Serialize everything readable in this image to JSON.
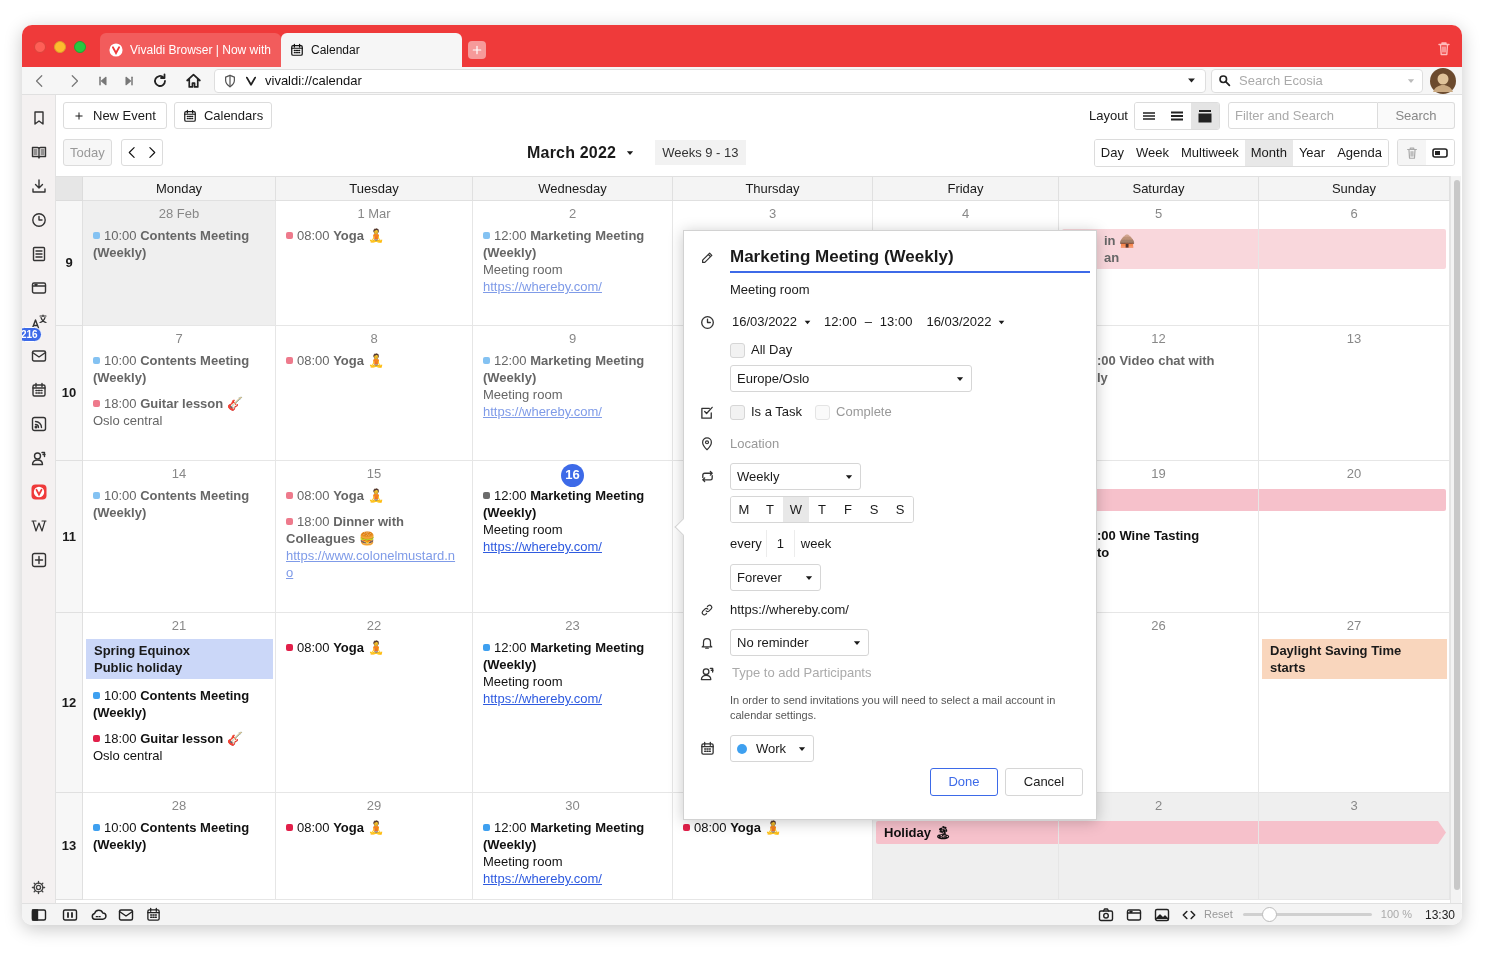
{
  "tabs": [
    {
      "title": "Vivaldi Browser | Now with",
      "selected": false,
      "kind": "vivaldi"
    },
    {
      "title": "Calendar",
      "selected": true,
      "kind": "calendar"
    }
  ],
  "address_bar": {
    "url": "vivaldi://calendar",
    "search_placeholder": "Search Ecosia"
  },
  "sidebar": {
    "mail_badge": "216"
  },
  "toolbar": {
    "new_event": "New Event",
    "calendars": "Calendars",
    "layout_label": "Layout",
    "layouts": [
      {
        "selected": false
      },
      {
        "selected": false
      },
      {
        "selected": true
      }
    ],
    "filter_placeholder": "Filter and Search",
    "search_button": "Search",
    "today": "Today",
    "today_disabled": true,
    "month_title": "March 2022",
    "weeks_label": "Weeks 9 - 13",
    "views": [
      {
        "label": "Day",
        "selected": false
      },
      {
        "label": "Week",
        "selected": false
      },
      {
        "label": "Multiweek",
        "selected": false
      },
      {
        "label": "Month",
        "selected": true
      },
      {
        "label": "Year",
        "selected": false
      },
      {
        "label": "Agenda",
        "selected": false
      }
    ]
  },
  "calendar": {
    "days": [
      "Monday",
      "Tuesday",
      "Wednesday",
      "Thursday",
      "Friday",
      "Saturday",
      "Sunday"
    ],
    "weeks": [
      {
        "number": "9",
        "cells": [
          {
            "date": "28 Feb",
            "other_month": true,
            "events": [
              {
                "kind": "timed",
                "color": "#84c2f2",
                "past": true,
                "text": "10:00 **Contents Meeting (Weekly)**"
              }
            ]
          },
          {
            "date": "1 Mar",
            "other_month": false,
            "events": [
              {
                "kind": "timed",
                "color": "#ee7a8c",
                "past": true,
                "text": "08:00 **Yoga** 🧘"
              }
            ]
          },
          {
            "date": "2",
            "other_month": false,
            "events": [
              {
                "kind": "timed",
                "color": "#84c2f2",
                "past": true,
                "text": "12:00 **Marketing Meeting (Weekly)**",
                "location": "Meeting room",
                "link": "https://whereby.com/"
              }
            ]
          },
          {
            "date": "3",
            "other_month": false
          },
          {
            "date": "4",
            "other_month": false
          },
          {
            "date": "5",
            "other_month": false,
            "events": [
              {
                "kind": "bar",
                "color": "#f9d7dc",
                "past": true,
                "lines": [
                  "in 🛖",
                  "an"
                ]
              }
            ]
          },
          {
            "date": "6",
            "other_month": false
          }
        ]
      },
      {
        "number": "10",
        "cells": [
          {
            "date": "7",
            "other_month": false,
            "events": [
              {
                "kind": "timed",
                "color": "#84c2f2",
                "past": true,
                "text": "10:00 **Contents Meeting (Weekly)**"
              },
              {
                "kind": "timed",
                "color": "#ee7a8c",
                "past": true,
                "text": "18:00 **Guitar lesson** 🎸",
                "location": "Oslo central"
              }
            ]
          },
          {
            "date": "8",
            "other_month": false,
            "events": [
              {
                "kind": "timed",
                "color": "#ee7a8c",
                "past": true,
                "text": "08:00 **Yoga** 🧘"
              }
            ]
          },
          {
            "date": "9",
            "other_month": false,
            "events": [
              {
                "kind": "timed",
                "color": "#84c2f2",
                "past": true,
                "text": "12:00 **Marketing Meeting (Weekly)**",
                "location": "Meeting room",
                "link": "https://whereby.com/"
              }
            ]
          },
          {
            "other_month": false
          },
          {},
          {
            "date": "12",
            "other_month": false,
            "events": [
              {
                "kind": "fragment",
                "past": true,
                "lines": [
                  ":00 Video chat with",
                  "ly"
                ]
              }
            ]
          },
          {
            "date": "13",
            "other_month": false
          }
        ]
      },
      {
        "number": "11",
        "cells": [
          {
            "date": "14",
            "other_month": false,
            "events": [
              {
                "kind": "timed",
                "color": "#84c2f2",
                "past": true,
                "text": "10:00 **Contents Meeting (Weekly)**"
              }
            ]
          },
          {
            "date": "15",
            "other_month": false,
            "events": [
              {
                "kind": "timed",
                "color": "#ee7a8c",
                "past": true,
                "text": "08:00 **Yoga** 🧘"
              },
              {
                "kind": "timed",
                "color": "#ee7a8c",
                "past": true,
                "text": "18:00 **Dinner with Colleagues** 🍔",
                "link": "https://www.colonelmustard.no"
              }
            ]
          },
          {
            "date": "16",
            "today": true,
            "other_month": false,
            "events": [
              {
                "kind": "timed",
                "color": "#6b6b6b",
                "past": false,
                "text": "12:00 **Marketing Meeting (Weekly)**",
                "location": "Meeting room",
                "link": "https://whereby.com/"
              }
            ]
          },
          {
            "other_month": false
          },
          {},
          {
            "date": "19",
            "other_month": false,
            "events": [
              {
                "kind": "bar",
                "color": "#f6c1cb"
              },
              {
                "kind": "fragment",
                "past": false,
                "lines": [
                  ":00 Wine Tasting",
                  "to"
                ]
              }
            ]
          },
          {
            "date": "20",
            "other_month": false
          }
        ]
      },
      {
        "number": "12",
        "cells": [
          {
            "date": "21",
            "other_month": false,
            "events": [
              {
                "kind": "allday",
                "color": "#cbd7f8",
                "lines": [
                  "Spring Equinox",
                  "Public holiday"
                ]
              },
              {
                "kind": "timed",
                "color": "#3ea0f0",
                "past": false,
                "text": "10:00 **Contents Meeting (Weekly)**"
              },
              {
                "kind": "timed",
                "color": "#e2204a",
                "past": false,
                "text": "18:00 **Guitar lesson** 🎸",
                "location": "Oslo central"
              }
            ]
          },
          {
            "date": "22",
            "other_month": false,
            "events": [
              {
                "kind": "timed",
                "color": "#e2204a",
                "past": false,
                "text": "08:00 **Yoga** 🧘"
              }
            ]
          },
          {
            "date": "23",
            "other_month": false,
            "events": [
              {
                "kind": "timed",
                "color": "#3ea0f0",
                "past": false,
                "text": "12:00 **Marketing Meeting (Weekly)**",
                "location": "Meeting room",
                "link": "https://whereby.com/"
              }
            ]
          },
          {
            "other_month": false
          },
          {},
          {
            "date": "26",
            "other_month": false
          },
          {
            "date": "27",
            "other_month": false,
            "events": [
              {
                "kind": "allday",
                "color": "#f9d6bd",
                "lines": [
                  "Daylight Saving Time starts"
                ]
              }
            ]
          }
        ]
      },
      {
        "number": "13",
        "cells": [
          {
            "date": "28",
            "other_month": false,
            "events": [
              {
                "kind": "timed",
                "color": "#3ea0f0",
                "past": false,
                "text": "10:00 **Contents Meeting (Weekly)**"
              }
            ]
          },
          {
            "date": "29",
            "other_month": false,
            "events": [
              {
                "kind": "timed",
                "color": "#e2204a",
                "past": false,
                "text": "08:00 **Yoga** 🧘"
              }
            ]
          },
          {
            "date": "30",
            "other_month": false,
            "events": [
              {
                "kind": "timed",
                "color": "#3ea0f0",
                "past": false,
                "text": "12:00 **Marketing Meeting (Weekly)**",
                "location": "Meeting room",
                "link": "https://whereby.com/"
              }
            ]
          },
          {
            "other_month": false,
            "events": [
              {
                "kind": "timed",
                "color": "#e2204a",
                "past": false,
                "text": "08:00 **Yoga** 🧘"
              }
            ]
          },
          {
            "other_month": true,
            "events": [
              {
                "kind": "bar",
                "color": "#f6c1cb",
                "past": false,
                "arrow": true,
                "lines": [
                  "Holiday 🏝"
                ]
              }
            ]
          },
          {
            "date": "2",
            "other_month": true
          },
          {
            "date": "3",
            "other_month": true
          }
        ]
      }
    ]
  },
  "event_editor": {
    "title": "Marketing Meeting (Weekly)",
    "description": "Meeting room",
    "start_date": "16/03/2022",
    "start_time": "12:00",
    "separator": "–",
    "end_time": "13:00",
    "end_date": "16/03/2022",
    "all_day": {
      "label": "All Day",
      "checked": false
    },
    "timezone": "Europe/Oslo",
    "is_task": {
      "label": "Is a Task",
      "checked": false
    },
    "complete": {
      "label": "Complete",
      "checked": false,
      "disabled": true
    },
    "location_placeholder": "Location",
    "repeat": "Weekly",
    "weekdays": [
      {
        "label": "M",
        "selected": false
      },
      {
        "label": "T",
        "selected": false
      },
      {
        "label": "W",
        "selected": true
      },
      {
        "label": "T",
        "selected": false
      },
      {
        "label": "F",
        "selected": false
      },
      {
        "label": "S",
        "selected": false
      },
      {
        "label": "S",
        "selected": false
      }
    ],
    "every_label": "every",
    "every_value": "1",
    "every_unit": "week",
    "repeat_end": "Forever",
    "url": "https://whereby.com/",
    "reminder": "No reminder",
    "participants_placeholder": "Type to add Participants",
    "invite_note": "In order to send invitations you will need to select a mail account in calendar settings.",
    "calendar": {
      "name": "Work",
      "color": "#3ea0f0"
    },
    "done": "Done",
    "cancel": "Cancel"
  },
  "status_bar": {
    "reset": "Reset",
    "zoom": {
      "level": 0.2
    },
    "zoom_label": "100 %",
    "clock": "13:30"
  }
}
